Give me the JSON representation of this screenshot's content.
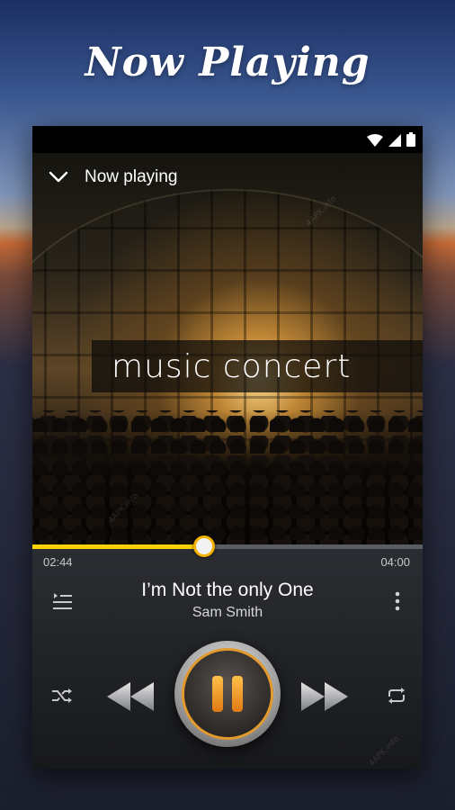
{
  "promo": {
    "title": "Now Playing"
  },
  "header": {
    "title": "Now playing",
    "back_icon": "chevron-down-icon"
  },
  "album_art": {
    "banner_text": "music concert"
  },
  "playback": {
    "elapsed": "02:44",
    "duration": "04:00",
    "progress": 0.44
  },
  "track": {
    "title": "I’m Not the only One",
    "artist": "Sam Smith"
  },
  "controls": {
    "queue_icon": "queue-list-icon",
    "more_icon": "more-vert-icon",
    "shuffle_icon": "shuffle-icon",
    "prev_icon": "rewind-icon",
    "pause_icon": "pause-icon",
    "next_icon": "fast-forward-icon",
    "repeat_icon": "repeat-icon"
  },
  "watermark": {
    "text": "4APK.info"
  },
  "colors": {
    "accent": "#f7d100",
    "pause_orange": "#e07a12",
    "background": "#16181d"
  }
}
